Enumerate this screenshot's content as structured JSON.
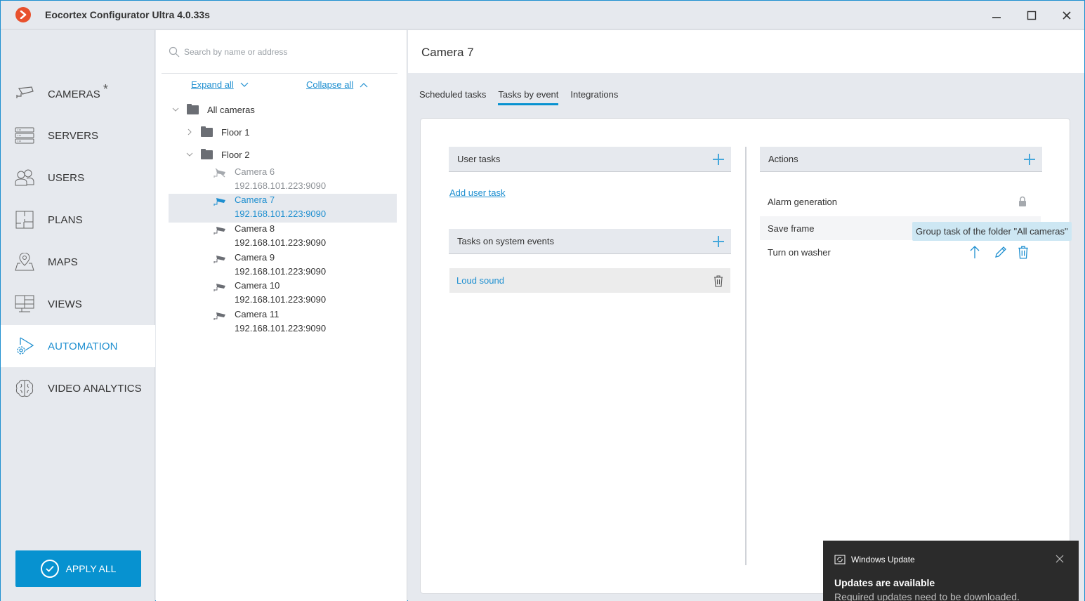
{
  "app": {
    "title": "Eocortex Configurator Ultra 4.0.33s",
    "accent_color": "#0792d0",
    "logo_color": "#e8512d"
  },
  "window_controls": {
    "minimize": "minimize-icon",
    "maximize": "maximize-icon",
    "close": "close-icon"
  },
  "sidebar": {
    "items": [
      {
        "label": "CAMERAS",
        "icon": "camera-icon",
        "modified_marker": "*"
      },
      {
        "label": "SERVERS",
        "icon": "servers-icon"
      },
      {
        "label": "USERS",
        "icon": "users-icon"
      },
      {
        "label": "PLANS",
        "icon": "plans-icon"
      },
      {
        "label": "MAPS",
        "icon": "map-pin-icon"
      },
      {
        "label": "VIEWS",
        "icon": "monitor-icon"
      },
      {
        "label": "AUTOMATION",
        "icon": "automation-icon",
        "active": true
      },
      {
        "label": "VIDEO ANALYTICS",
        "icon": "brain-icon"
      }
    ],
    "apply_all_label": "APPLY ALL"
  },
  "tree": {
    "search_placeholder": "Search by name or address",
    "search_value": "",
    "expand_all": "Expand all",
    "collapse_all": "Collapse all",
    "root": "All cameras",
    "folders": [
      {
        "label": "Floor 1",
        "expanded": false
      },
      {
        "label": "Floor 2",
        "expanded": true
      }
    ],
    "cameras": [
      {
        "name": "Camera 6",
        "address": "192.168.101.223:9090",
        "state": "offline"
      },
      {
        "name": "Camera 7",
        "address": "192.168.101.223:9090",
        "state": "selected"
      },
      {
        "name": "Camera 8",
        "address": "192.168.101.223:9090",
        "state": "online"
      },
      {
        "name": "Camera 9",
        "address": "192.168.101.223:9090",
        "state": "online"
      },
      {
        "name": "Camera 10",
        "address": "192.168.101.223:9090",
        "state": "online"
      },
      {
        "name": "Camera 11",
        "address": "192.168.101.223:9090",
        "state": "online"
      }
    ]
  },
  "main": {
    "title": "Camera 7",
    "tabs": [
      {
        "label": "Scheduled tasks"
      },
      {
        "label": "Tasks by event",
        "active": true
      },
      {
        "label": "Integrations"
      }
    ],
    "user_tasks": {
      "header": "User tasks",
      "add_link": "Add user task"
    },
    "system_events": {
      "header": "Tasks on system events",
      "items": [
        "Loud sound"
      ]
    },
    "actions": {
      "header": "Actions",
      "items": [
        {
          "label": "Alarm generation",
          "locked": true
        },
        {
          "label": "Save frame",
          "hovered": true
        },
        {
          "label": "Turn on washer"
        }
      ],
      "tooltip": "Group task of the folder \"All cameras\""
    }
  },
  "toast": {
    "app": "Windows Update",
    "title": "Updates are available",
    "body": "Required updates need to be downloaded."
  }
}
